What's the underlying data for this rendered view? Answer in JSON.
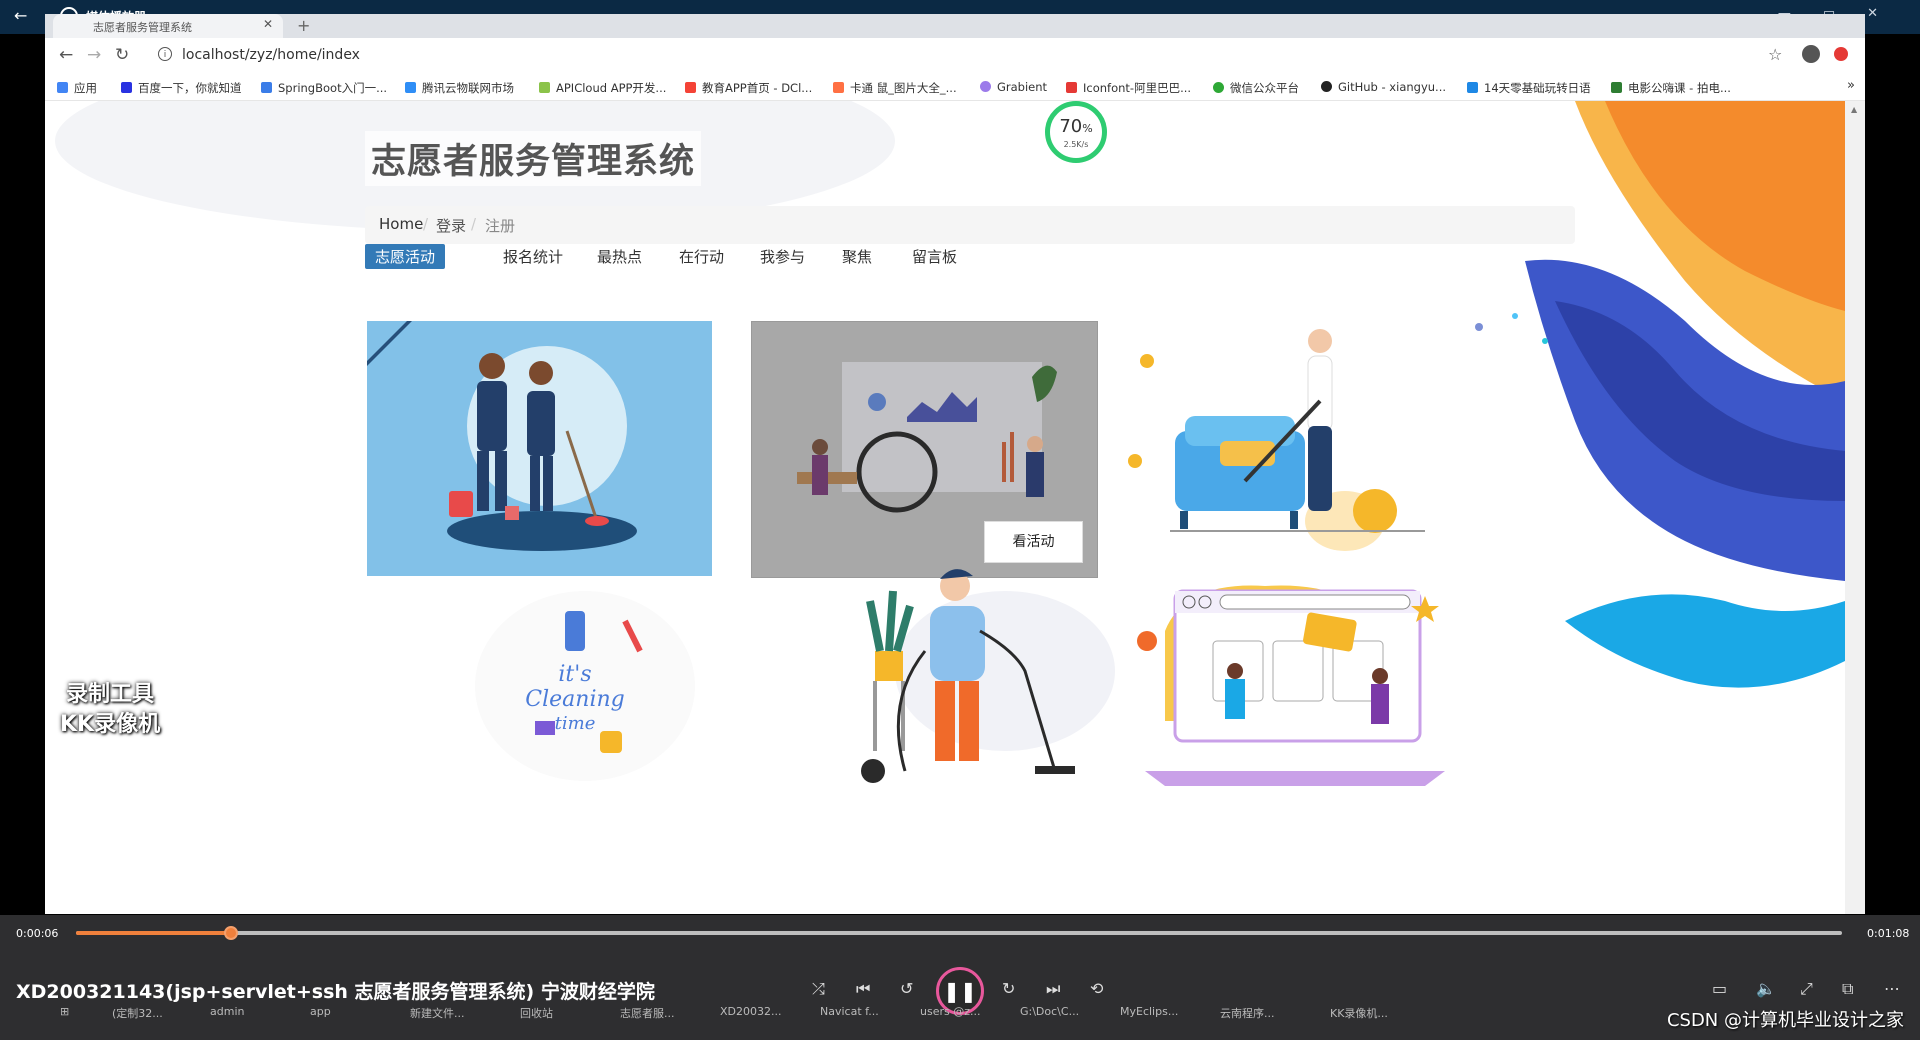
{
  "media_player": {
    "app_title": "媒体播放器",
    "back_icon": "back-arrow-icon"
  },
  "browser": {
    "tab_title": "志愿者服务管理系统",
    "url": "localhost/zyz/home/index",
    "bookmarks": [
      {
        "label": "应用",
        "color": "#4285f4"
      },
      {
        "label": "百度一下，你就知道",
        "color": "#2932e1"
      },
      {
        "label": "SpringBoot入门一...",
        "color": "#3b7de8"
      },
      {
        "label": "腾讯云物联网市场",
        "color": "#2f8ef6"
      },
      {
        "label": "APICloud APP开发...",
        "color": "#8bc34a"
      },
      {
        "label": "教育APP首页 - DCl...",
        "color": "#f44336"
      },
      {
        "label": "卡通 鼠_图片大全_...",
        "color": "#ff7043"
      },
      {
        "label": "Grabient",
        "color": "#9c7bea"
      },
      {
        "label": "Iconfont-阿里巴巴...",
        "color": "#e53935"
      },
      {
        "label": "微信公众平台",
        "color": "#2ea836"
      },
      {
        "label": "GitHub - xiangyu...",
        "color": "#222222"
      },
      {
        "label": "14天零基础玩转日语",
        "color": "#1e88e5"
      },
      {
        "label": "电影公嗨课 - 拍电...",
        "color": "#2e7d32"
      }
    ]
  },
  "page": {
    "site_title": "志愿者服务管理系统",
    "breadcrumb": [
      "Home",
      "登录",
      "注册"
    ],
    "nav_tabs": [
      "志愿活动",
      "报名统计",
      "最热点",
      "在行动",
      "我参与",
      "聚焦",
      "留言板"
    ],
    "card_button": "看活动",
    "speed_widget": {
      "percent": "70",
      "unit": "%",
      "rate": "2.5K/s"
    }
  },
  "watermark": {
    "line1": "录制工具",
    "line2": "KK录像机"
  },
  "player": {
    "elapsed": "0:00:06",
    "total": "0:01:08",
    "progress": 0.088,
    "video_title": "XD200321143(jsp+servlet+ssh 志愿者服务管理系统) 宁波财经学院",
    "accent": "#f0803c"
  },
  "taskbar": [
    "(定制32...",
    "admin",
    "app",
    "新建文件...",
    "回收站",
    "志愿者服...",
    "XD20032...",
    "Navicat f...",
    "users @z...",
    "G:\\Doc\\C...",
    "MyEclips...",
    "云南程序...",
    "KK录像机..."
  ],
  "csdn_credit": "CSDN @计算机毕业设计之家"
}
